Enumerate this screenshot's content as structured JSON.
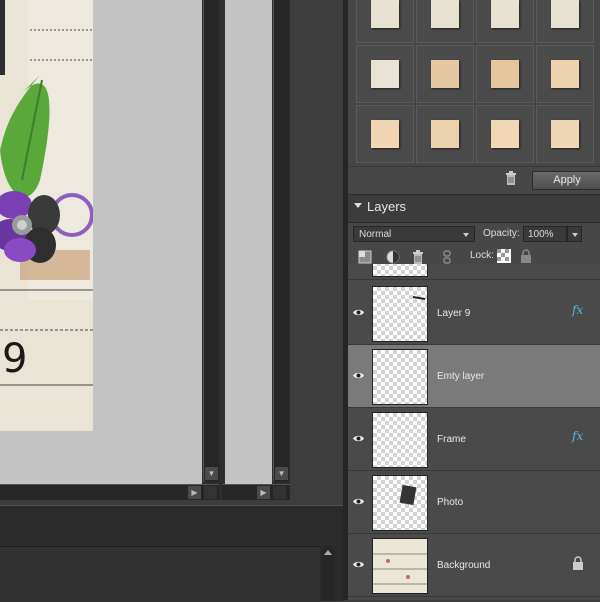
{
  "effects_panel": {
    "apply_label": "Apply",
    "swatches": [
      [
        "#e8e2d3",
        "#e8e2d3",
        "#e8e2d3",
        "#e8e2d3"
      ],
      [
        "#e9e3d5",
        "#e4c9a2",
        "#e4c59c",
        "#ecd3ad"
      ],
      [
        "#f0d6b3",
        "#ecd2ac",
        "#f0d7b6",
        "#efd6b4"
      ]
    ]
  },
  "layers_panel": {
    "title": "Layers",
    "blend_mode": "Normal",
    "opacity_label": "Opacity:",
    "opacity_value": "100%",
    "lock_label": "Lock:",
    "layers": [
      {
        "name": "Layer 9",
        "fx": "fx",
        "selected": false
      },
      {
        "name": "Emty layer",
        "fx": "",
        "selected": true
      },
      {
        "name": "Frame",
        "fx": "fx",
        "selected": false
      },
      {
        "name": "Photo",
        "fx": "",
        "selected": false
      },
      {
        "name": "Background",
        "fx": "",
        "selected": false
      }
    ]
  },
  "colors": {
    "selected_row": "#7a7a7a",
    "fx_color": "#5bb3e6",
    "leaf": "#5aa83a",
    "flower": "#7a3fb3"
  },
  "icons": [
    "eye-icon",
    "trash-icon",
    "new-layer-icon",
    "adjustment-icon",
    "link-icon",
    "lock-transparent-icon",
    "lock-icon",
    "scroll-down-arrow-icon",
    "scroll-right-arrow-icon"
  ]
}
